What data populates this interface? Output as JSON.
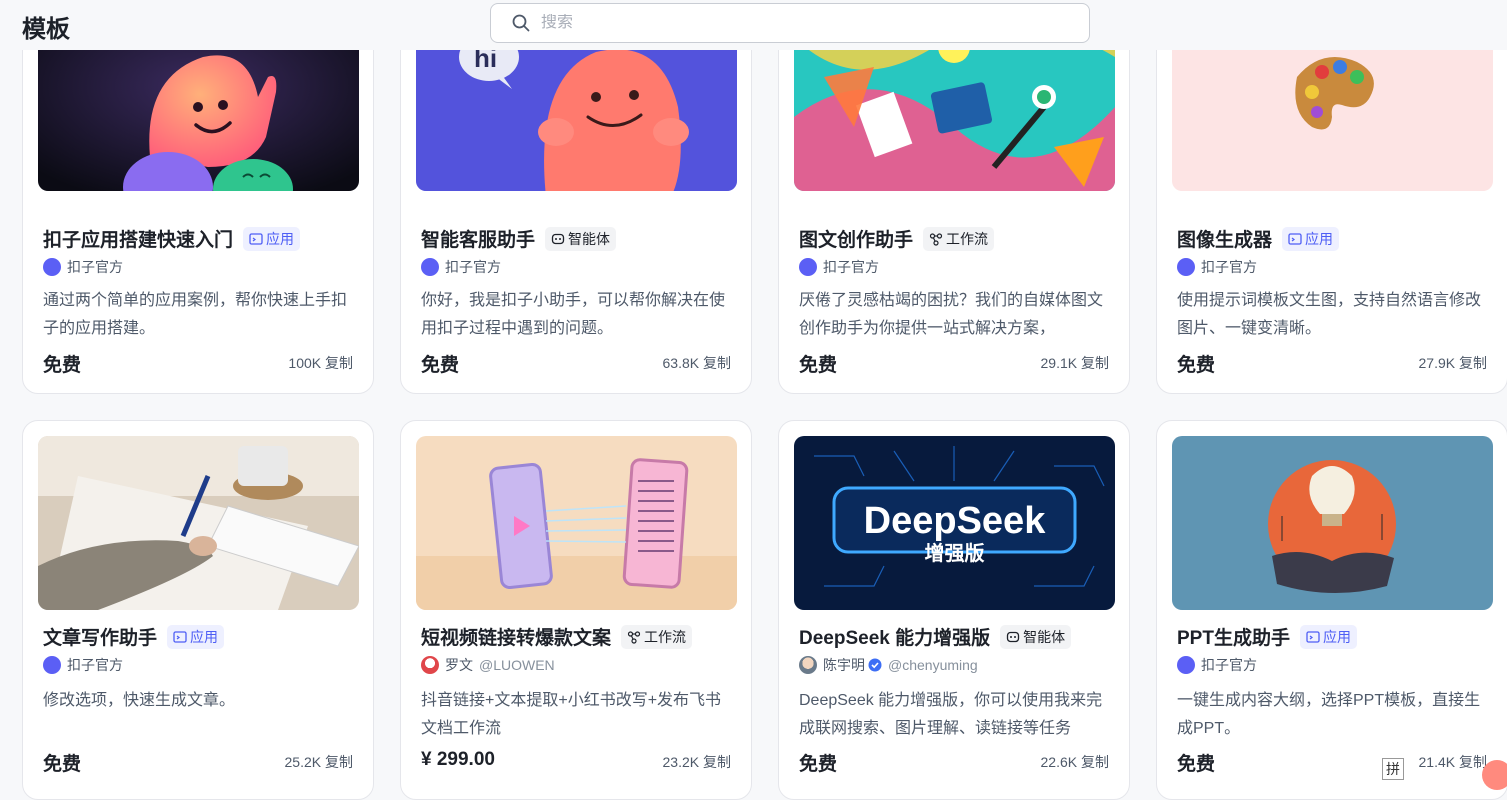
{
  "header": {
    "title": "模板",
    "search_placeholder": "搜索"
  },
  "row1": [
    {
      "title": "扣子应用搭建快速入门",
      "tag": "应用",
      "author": "扣子官方",
      "desc": "通过两个简单的应用案例，帮你快速上手扣子的应用搭建。",
      "price": "免费",
      "count": "100K",
      "copy": "复制"
    },
    {
      "title": "智能客服助手",
      "tag": "智能体",
      "author": "扣子官方",
      "desc": "你好，我是扣子小助手，可以帮你解决在使用扣子过程中遇到的问题。",
      "price": "免费",
      "count": "63.8K",
      "copy": "复制"
    },
    {
      "title": "图文创作助手",
      "tag": "工作流",
      "author": "扣子官方",
      "desc": "厌倦了灵感枯竭的困扰？我们的自媒体图文创作助手为你提供一站式解决方案，",
      "price": "免费",
      "count": "29.1K",
      "copy": "复制"
    },
    {
      "title": "图像生成器",
      "tag": "应用",
      "author": "扣子官方",
      "desc": "使用提示词模板文生图，支持自然语言修改图片、一键变清晰。",
      "price": "免费",
      "count": "27.9K",
      "copy": "复制"
    }
  ],
  "row2": [
    {
      "title": "文章写作助手",
      "tag": "应用",
      "author": "扣子官方",
      "handle": "",
      "desc": "修改选项，快速生成文章。",
      "price": "免费",
      "count": "25.2K",
      "copy": "复制"
    },
    {
      "title": "短视频链接转爆款文案",
      "tag": "工作流",
      "author": "罗文",
      "handle": "@LUOWEN",
      "desc": "抖音链接+文本提取+小红书改写+发布飞书文档工作流",
      "price": "¥ 299.00",
      "count": "23.2K",
      "copy": "复制"
    },
    {
      "title": "DeepSeek 能力增强版",
      "tag": "智能体",
      "author": "陈宇明",
      "handle": "@chenyuming",
      "desc": "DeepSeek 能力增强版，你可以使用我来完成联网搜索、图片理解、读链接等任务",
      "price": "免费",
      "count": "22.6K",
      "copy": "复制"
    },
    {
      "title": "PPT生成助手",
      "tag": "应用",
      "author": "扣子官方",
      "handle": "",
      "desc": "一键生成内容大纲，选择PPT模板，直接生成PPT。",
      "price": "免费",
      "count": "21.4K",
      "copy": "复制"
    }
  ],
  "thumb_text": {
    "hi": "hi",
    "deepseek_line1": "DeepSeek",
    "deepseek_line2": "增强版"
  },
  "ime_indicator": "拼",
  "colors": {
    "accent": "#4e5ef5",
    "tag_app_bg": "#eef0ff"
  }
}
